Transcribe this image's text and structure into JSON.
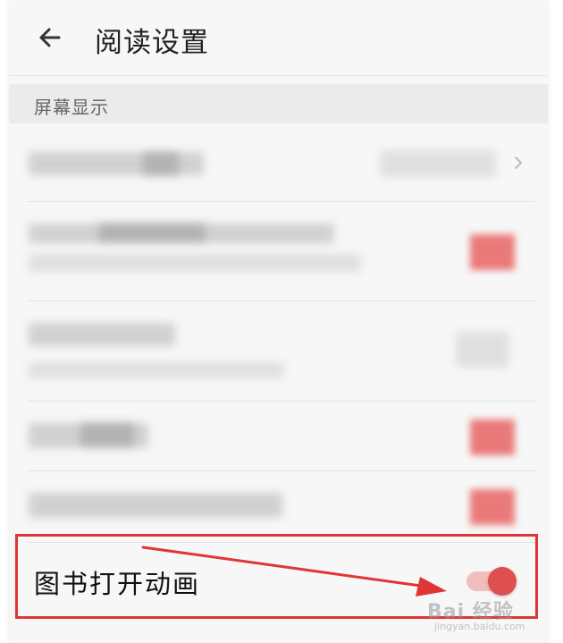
{
  "header": {
    "title": "阅读设置",
    "back_icon": "arrow-left-icon"
  },
  "section": {
    "label": "屏幕显示"
  },
  "highlighted_setting": {
    "label": "图书打开动画",
    "toggle_state": "on",
    "toggle_color": "#e04f4f"
  },
  "annotation": {
    "box_color": "#e03535",
    "arrow_color": "#e03535"
  },
  "watermark": {
    "text": "Bai 经验",
    "sub": "jingyan.baidu.com"
  }
}
